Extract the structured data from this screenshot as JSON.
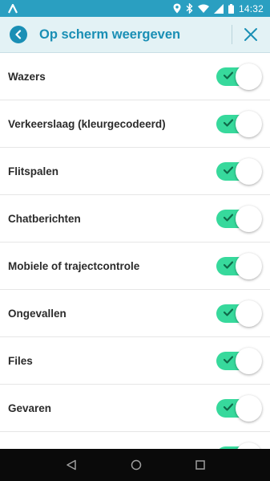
{
  "status_bar": {
    "time": "14:32"
  },
  "header": {
    "title": "Op scherm weergeven"
  },
  "settings": [
    {
      "label": "Wazers",
      "enabled": true
    },
    {
      "label": "Verkeerslaag (kleurgecodeerd)",
      "enabled": true
    },
    {
      "label": "Flitspalen",
      "enabled": true
    },
    {
      "label": "Chatberichten",
      "enabled": true
    },
    {
      "label": "Mobiele of trajectcontrole",
      "enabled": true
    },
    {
      "label": "Ongevallen",
      "enabled": true
    },
    {
      "label": "Files",
      "enabled": true
    },
    {
      "label": "Gevaren",
      "enabled": true
    },
    {
      "label": "",
      "enabled": true
    }
  ],
  "colors": {
    "status_bar": "#2a9fc1",
    "accent": "#1a8fb5",
    "app_bar_bg": "#e3f2f5",
    "toggle_on": "#37d99c"
  },
  "icons": {
    "status_left": "waze-notification-icon",
    "status_right": [
      "location-icon",
      "bluetooth-icon",
      "wifi-icon",
      "signal-icon",
      "battery-icon"
    ],
    "back": "chevron-left-icon",
    "close": "close-icon",
    "nav": [
      "back-triangle-icon",
      "home-circle-icon",
      "recents-square-icon"
    ]
  }
}
